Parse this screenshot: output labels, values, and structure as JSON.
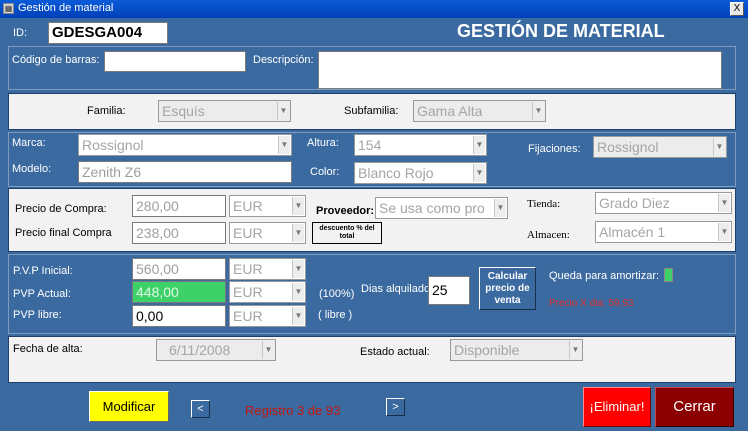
{
  "window": {
    "title": "Gestión de material",
    "close_glyph": "X",
    "icon": "app-icon"
  },
  "header": {
    "id_label": "ID:",
    "id_value": "GDESGA004",
    "title": "GESTIÓN DE MATERIAL"
  },
  "barcode": {
    "label": "Código de barras:",
    "value": "",
    "desc_label": "Descripción:",
    "desc_value": ""
  },
  "classification": {
    "familia_label": "Familia:",
    "familia_value": "Esquís",
    "subfamilia_label": "Subfamilia:",
    "subfamilia_value": "Gama Alta"
  },
  "product": {
    "marca_label": "Marca:",
    "marca_value": "Rossignol",
    "modelo_label": "Modelo:",
    "modelo_value": "Zenith Z6",
    "altura_label": "Altura:",
    "altura_value": "154",
    "color_label": "Color:",
    "color_value": "Blanco Rojo",
    "fijaciones_label": "Fijaciones:",
    "fijaciones_value": "Rossignol"
  },
  "purchase": {
    "precio_compra_label": "Precio de Compra:",
    "precio_compra_value": "280,00",
    "precio_compra_currency": "EUR",
    "precio_final_label": "Precio final Compra",
    "precio_final_value": "238,00",
    "precio_final_currency": "EUR",
    "proveedor_label": "Proveedor:",
    "proveedor_value": "Se usa como pro",
    "descuento_button": "descuento % del total",
    "tienda_label": "Tienda:",
    "tienda_value": "Grado Diez",
    "almacen_label": "Almacen:",
    "almacen_value": "Almacén 1"
  },
  "sale": {
    "pvp_inicial_label": "P.V.P Inicial:",
    "pvp_inicial_value": "560,00",
    "pvp_inicial_currency": "EUR",
    "pvp_actual_label": "PVP Actual:",
    "pvp_actual_value": "448,00",
    "pvp_actual_currency": "EUR",
    "pvp_libre_label": "PVP libre:",
    "pvp_libre_value": "0,00",
    "pvp_libre_currency": "EUR",
    "pct_actual": "(100%)",
    "libre_note": "( libre )",
    "dias_label": "Dias alquilado",
    "dias_value": "25",
    "calcular_button": "Calcular precio de venta",
    "amortizar_label": "Queda para amortizar:",
    "precio_x_dia": "Precio X dia: 59,93",
    "indicator_color": "#3ed16a"
  },
  "status": {
    "fecha_label": "Fecha de alta:",
    "fecha_value": "6/11/2008",
    "estado_label": "Estado actual:",
    "estado_value": "Disponible"
  },
  "footer": {
    "modificar_button": "Modificar",
    "prev_glyph": "<",
    "next_glyph": ">",
    "registro_text": "Registro 3 de 93",
    "eliminar_button": "¡Eliminar!",
    "cerrar_button": "Cerrar"
  },
  "colors": {
    "background": "#3b6aa0",
    "modificar": "#ffff00",
    "eliminar": "#ff0000",
    "cerrar": "#8b0000",
    "registro_text": "#c0180e",
    "precio_dia_text": "#e0302a"
  }
}
